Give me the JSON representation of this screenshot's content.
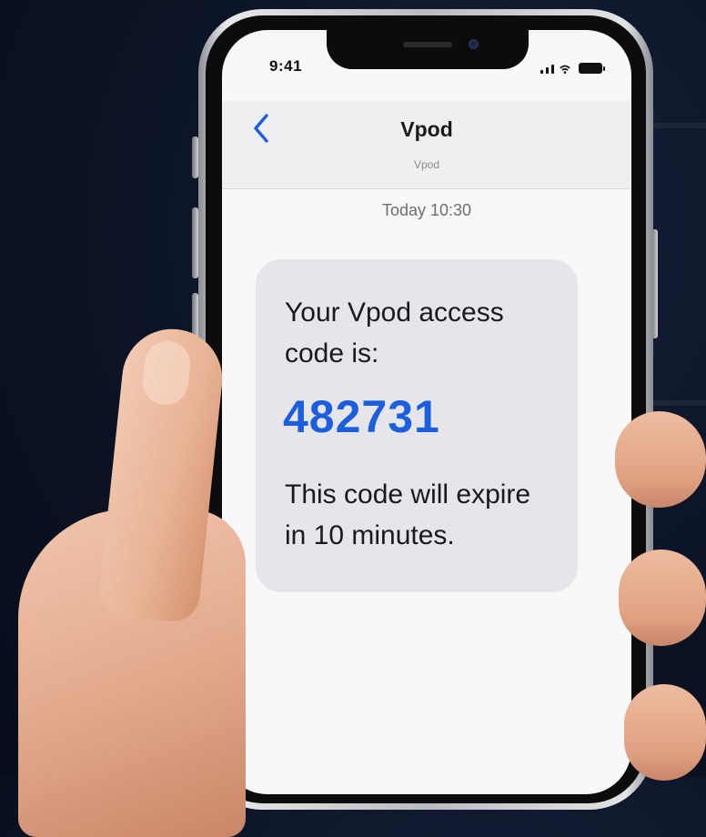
{
  "status_bar": {
    "time": "9:41"
  },
  "conversation": {
    "contact_name": "Vpod",
    "contact_subtitle": "Vpod",
    "back_icon": "chevron-left-icon",
    "timestamp": "Today 10:30"
  },
  "message": {
    "line1": "Your Vpod access",
    "line2": "code is:",
    "code": "482731",
    "line3": "This code will expire",
    "line4": "in 10 minutes."
  },
  "colors": {
    "accent": "#1b5ede",
    "bubble": "#e5e5ea",
    "background": "#0b1325"
  }
}
